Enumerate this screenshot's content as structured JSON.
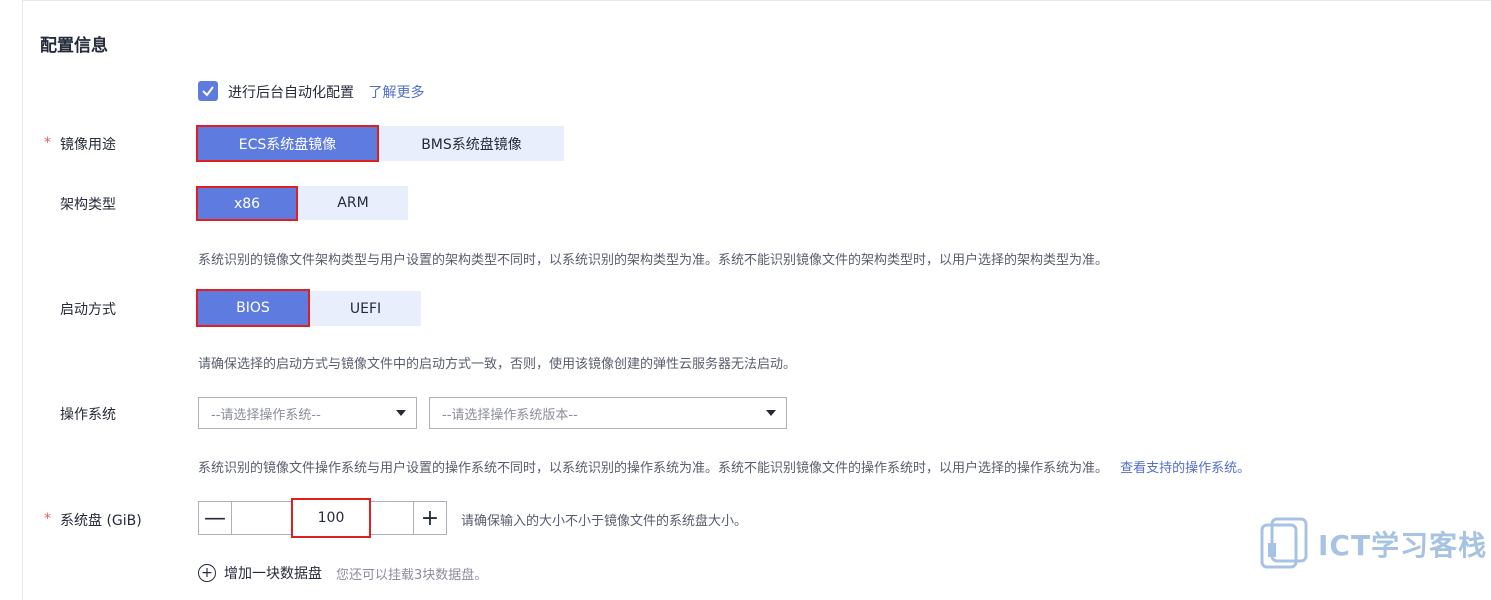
{
  "section": {
    "title": "配置信息"
  },
  "auto_config": {
    "label": "进行后台自动化配置",
    "link": "了解更多",
    "checked": true
  },
  "image_usage": {
    "label": "镜像用途",
    "required": "*",
    "options": [
      "ECS系统盘镜像",
      "BMS系统盘镜像"
    ],
    "selected": "ECS系统盘镜像"
  },
  "arch": {
    "label": "架构类型",
    "options": [
      "x86",
      "ARM"
    ],
    "selected": "x86",
    "hint": "系统识别的镜像文件架构类型与用户设置的架构类型不同时，以系统识别的架构类型为准。系统不能识别镜像文件的架构类型时，以用户选择的架构类型为准。"
  },
  "boot": {
    "label": "启动方式",
    "options": [
      "BIOS",
      "UEFI"
    ],
    "selected": "BIOS",
    "hint": "请确保选择的启动方式与镜像文件中的启动方式一致，否则，使用该镜像创建的弹性云服务器无法启动。"
  },
  "os": {
    "label": "操作系统",
    "os_placeholder": "--请选择操作系统--",
    "version_placeholder": "--请选择操作系统版本--",
    "hint": "系统识别的镜像文件操作系统与用户设置的操作系统不同时，以系统识别的操作系统为准。系统不能识别镜像文件的操作系统时，以用户选择的操作系统为准。",
    "hint_link": "查看支持的操作系统。"
  },
  "system_disk": {
    "label": "系统盘 (GiB)",
    "required": "*",
    "value": "100",
    "minus": "—",
    "plus": "+",
    "hint": "请确保输入的大小不小于镜像文件的系统盘大小。"
  },
  "data_disk": {
    "add_label": "增加一块数据盘",
    "add_icon": "+",
    "hint": "您还可以挂载3块数据盘。"
  },
  "watermark": {
    "text": "ICT学习客栈"
  },
  "colors": {
    "accent": "#5e7ce0",
    "highlight_border": "#e02020",
    "segment_off": "#e9eefc",
    "link": "#526ecc"
  }
}
